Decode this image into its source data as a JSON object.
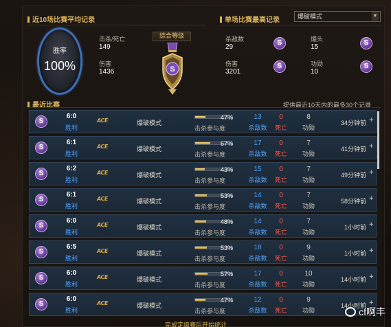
{
  "avg_section": {
    "title": "近10场比赛平均记录",
    "win_rate_label": "胜率",
    "win_rate_value": "100%",
    "kd_label": "击杀/死亡",
    "kd_value": "149",
    "damage_label": "伤害",
    "damage_value": "1436",
    "rank_label": "综合等级"
  },
  "best_section": {
    "title": "单场比赛最高记录",
    "mode_select": "爆破模式",
    "kills_label": "杀敌数",
    "kills_value": "29",
    "headshot_label": "爆头",
    "headshot_value": "15",
    "damage_label": "伤害",
    "damage_value": "3201",
    "merit_label": "功勋",
    "merit_value": "10",
    "badge_letter": "S"
  },
  "recent": {
    "title": "最近比赛",
    "note": "提供最近10天内的最多30个记录",
    "columns": {
      "participation": "击杀参与度",
      "kills": "杀敌数",
      "deaths": "死亡",
      "merit": "功勋"
    },
    "rows": [
      {
        "rank": "S",
        "score": "6:0",
        "result": "胜利",
        "ace": "ACE",
        "mode": "爆破模式",
        "participation": 0.47,
        "participation_text": "47%",
        "kills": "13",
        "deaths": "0",
        "merit": "8",
        "time": "34分钟前"
      },
      {
        "rank": "S",
        "score": "6:1",
        "result": "胜利",
        "ace": "ACE",
        "mode": "爆破模式",
        "participation": 0.67,
        "participation_text": "67%",
        "kills": "17",
        "deaths": "0",
        "merit": "7",
        "time": "41分钟前"
      },
      {
        "rank": "S",
        "score": "6:2",
        "result": "胜利",
        "ace": "ACE",
        "mode": "爆破模式",
        "participation": 0.43,
        "participation_text": "43%",
        "kills": "15",
        "deaths": "0",
        "merit": "7",
        "time": "49分钟前"
      },
      {
        "rank": "S",
        "score": "6:1",
        "result": "胜利",
        "ace": "ACE",
        "mode": "爆破模式",
        "participation": 0.53,
        "participation_text": "53%",
        "kills": "14",
        "deaths": "0",
        "merit": "7",
        "time": "58分钟前"
      },
      {
        "rank": "S",
        "score": "6:0",
        "result": "胜利",
        "ace": "ACE",
        "mode": "爆破模式",
        "participation": 0.48,
        "participation_text": "48%",
        "kills": "14",
        "deaths": "0",
        "merit": "7",
        "time": "1小时前"
      },
      {
        "rank": "S",
        "score": "6:5",
        "result": "胜利",
        "ace": "ACE",
        "mode": "爆破模式",
        "participation": 0.53,
        "participation_text": "53%",
        "kills": "18",
        "deaths": "0",
        "merit": "9",
        "time": "1小时前"
      },
      {
        "rank": "S",
        "score": "6:0",
        "result": "胜利",
        "ace": "ACE",
        "mode": "爆破模式",
        "participation": 0.57,
        "participation_text": "57%",
        "kills": "17",
        "deaths": "0",
        "merit": "10",
        "time": "14小时前"
      },
      {
        "rank": "S",
        "score": "6:0",
        "result": "胜利",
        "ace": "ACE",
        "mode": "爆破模式",
        "participation": 0.47,
        "participation_text": "47%",
        "kills": "12",
        "deaths": "0",
        "merit": "9",
        "time": "14小时前"
      }
    ],
    "more_symbol": "+"
  },
  "footer": "完成定级赛后开始统计",
  "watermark": "cf啊丰",
  "colors": {
    "gold": "#d9b35a",
    "blue": "#4ea3ff",
    "red": "#ff5a4a",
    "purple": "#7b4bb3"
  }
}
